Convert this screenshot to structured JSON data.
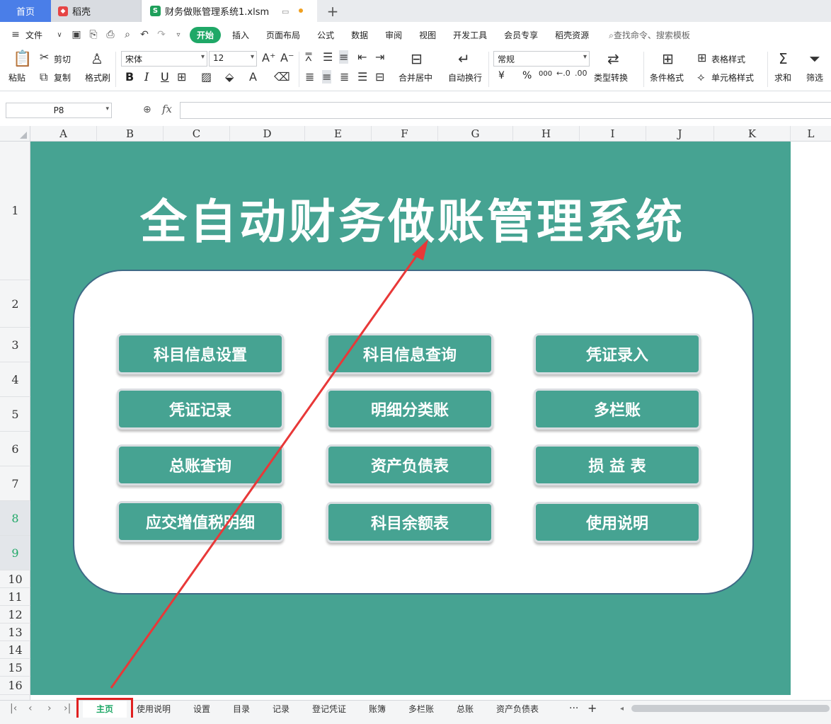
{
  "tabs": {
    "home": "首页",
    "daoke": "稻壳",
    "file": "财务做账管理系统1.xlsm",
    "plus": "+"
  },
  "menu": {
    "file": "文件",
    "items": [
      "开始",
      "插入",
      "页面布局",
      "公式",
      "数据",
      "审阅",
      "视图",
      "开发工具",
      "会员专享",
      "稻壳资源"
    ],
    "active": "开始",
    "search": "查找命令、搜索模板"
  },
  "ribbon": {
    "paste": "粘贴",
    "cut": "剪切",
    "copy": "复制",
    "format_painter": "格式刷",
    "font_name": "宋体",
    "font_size": "12",
    "bold": "B",
    "italic": "I",
    "underline": "U",
    "merge_center": "合并居中",
    "wrap": "自动换行",
    "number_format": "常规",
    "currency": "¥",
    "percent": "%",
    "thousands": "000",
    "type_convert": "类型转换",
    "cond_format": "条件格式",
    "table_style": "表格样式",
    "cell_style": "单元格样式",
    "sum": "求和",
    "filter": "筛选"
  },
  "formula_bar": {
    "name_box": "P8",
    "fx": "fx",
    "value": ""
  },
  "columns": [
    "A",
    "B",
    "C",
    "D",
    "E",
    "F",
    "G",
    "H",
    "I",
    "J",
    "K",
    "L"
  ],
  "rows": [
    "1",
    "2",
    "3",
    "4",
    "5",
    "6",
    "7",
    "8",
    "9",
    "10",
    "11",
    "12",
    "13",
    "14",
    "15",
    "16"
  ],
  "sheet": {
    "title": "全自动财务做账管理系统",
    "buttons": [
      [
        "科目信息设置",
        "科目信息查询",
        "凭证录入"
      ],
      [
        "凭证记录",
        "明细分类账",
        "多栏账"
      ],
      [
        "总账查询",
        "资产负债表",
        "损 益 表"
      ],
      [
        "应交增值税明细",
        "科目余额表",
        "使用说明"
      ]
    ],
    "bg_color": "#46a392"
  },
  "sheet_tabs": {
    "active": "主页",
    "items": [
      "主页",
      "使用说明",
      "设置",
      "目录",
      "记录",
      "登记凭证",
      "账簿",
      "多栏账",
      "总账",
      "资产负债表"
    ],
    "more": "···",
    "add": "+"
  },
  "colors": {
    "accent": "#1fa867",
    "annotation": "#e02020"
  }
}
